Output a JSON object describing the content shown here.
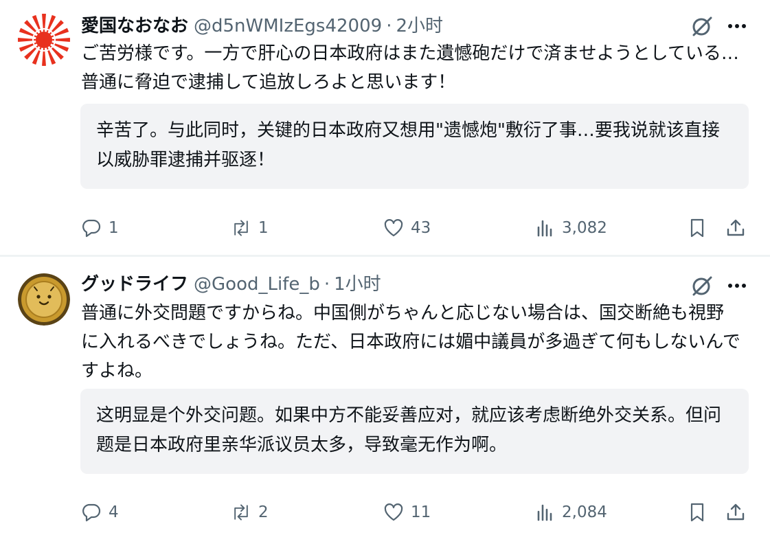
{
  "colors": {
    "text": "#0f1419",
    "secondary": "#536471",
    "translation_bg": "#f2f3f5",
    "avatar_sun": "#e8311e",
    "avatar_gold": "#c99a2e"
  },
  "tweets": [
    {
      "display_name": "愛国なおなお",
      "handle": "@d5nWMIzEgs42009",
      "separator": "·",
      "time": "2小时",
      "text": "ご苦労様です。一方で肝心の日本政府はまた遺憾砲だけで済ませようとしている…普通に脅迫で逮捕して追放しろよと思います！",
      "translation": "辛苦了。与此同时，关键的日本政府又想用\"遗憾炮\"敷衍了事…要我说就该直接以威胁罪逮捕并驱逐！",
      "replies": "1",
      "reposts": "1",
      "likes": "43",
      "views": "3,082"
    },
    {
      "display_name": "グッドライフ",
      "handle": "@Good_Life_b",
      "separator": "·",
      "time": "1小时",
      "text": "普通に外交問題ですからね。中国側がちゃんと応じない場合は、国交断絶も視野に入れるべきでしょうね。ただ、日本政府には媚中議員が多過ぎて何もしないんですよね。",
      "translation": "这明显是个外交问题。如果中方不能妥善应对，就应该考虑断绝外交关系。但问题是日本政府里亲华派议员太多，导致毫无作为啊。",
      "replies": "4",
      "reposts": "2",
      "likes": "11",
      "views": "2,084"
    }
  ],
  "icons": {
    "reply": "reply-icon",
    "repost": "repost-icon",
    "like": "heart-icon",
    "views": "views-icon",
    "bookmark": "bookmark-icon",
    "share": "share-icon",
    "grok": "grok-icon",
    "more": "more-icon"
  }
}
